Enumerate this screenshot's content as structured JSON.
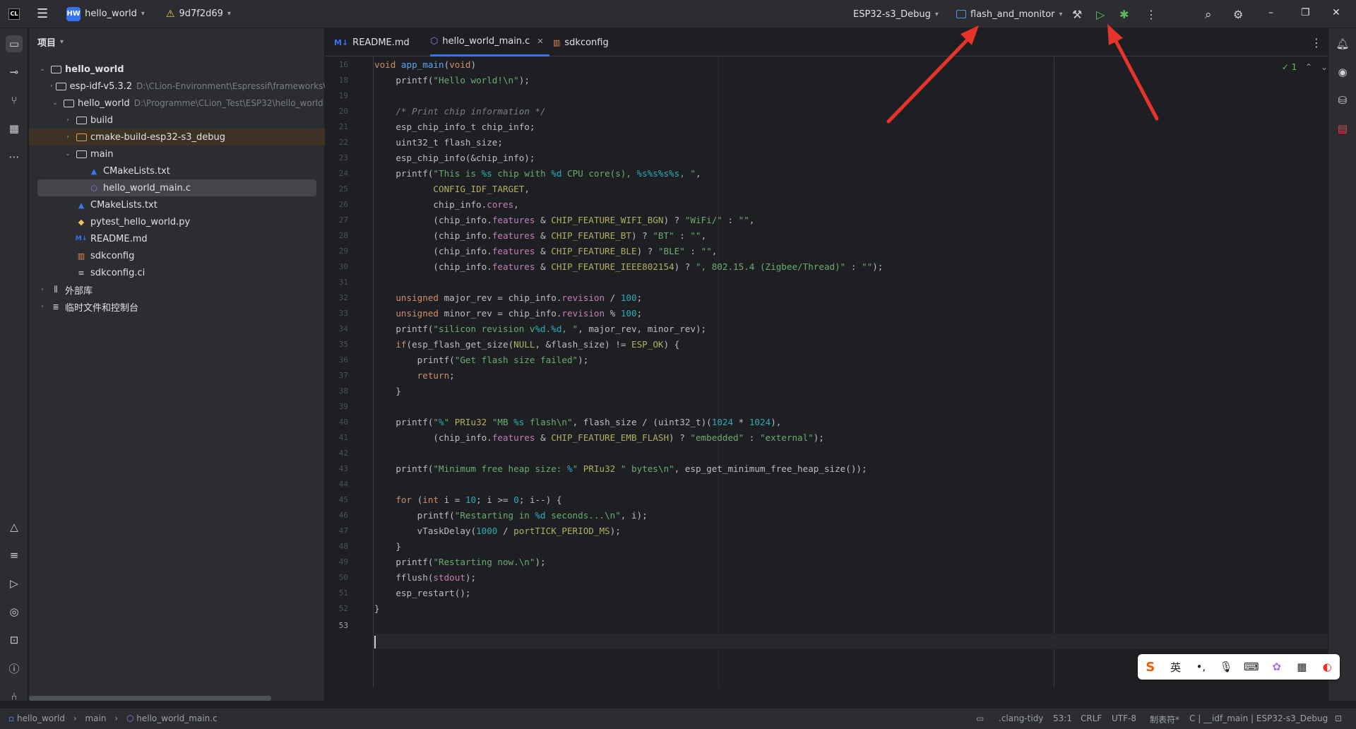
{
  "titlebar": {
    "logo_text": "CL",
    "project_badge": "HW",
    "project_name": "hello_world",
    "branch": "9d7f2d69",
    "run_config": "ESP32-s3_Debug",
    "flash_config": "flash_and_monitor"
  },
  "project_panel": {
    "title": "项目",
    "rows": [
      {
        "label": "hello_world",
        "path": ""
      },
      {
        "label": "esp-idf-v5.3.2",
        "path": "D:\\CLion-Environment\\Espressif\\frameworks\\"
      },
      {
        "label": "hello_world",
        "path": "D:\\Programme\\CLion_Test\\ESP32\\hello_world"
      },
      {
        "label": "build",
        "path": ""
      },
      {
        "label": "cmake-build-esp32-s3_debug",
        "path": ""
      },
      {
        "label": "main",
        "path": ""
      },
      {
        "label": "CMakeLists.txt",
        "path": ""
      },
      {
        "label": "hello_world_main.c",
        "path": ""
      },
      {
        "label": "CMakeLists.txt",
        "path": ""
      },
      {
        "label": "pytest_hello_world.py",
        "path": ""
      },
      {
        "label": "README.md",
        "path": ""
      },
      {
        "label": "sdkconfig",
        "path": ""
      },
      {
        "label": "sdkconfig.ci",
        "path": ""
      },
      {
        "label": "外部库",
        "path": ""
      },
      {
        "label": "临时文件和控制台",
        "path": ""
      }
    ]
  },
  "tabs": [
    {
      "label": "README.md",
      "icon": "M↓"
    },
    {
      "label": "hello_world_main.c",
      "icon": "⬡"
    },
    {
      "label": "sdkconfig",
      "icon": "▥"
    }
  ],
  "editor": {
    "inspection_count": "1",
    "line_numbers": [
      "16",
      "18",
      "19",
      "20",
      "21",
      "22",
      "23",
      "24",
      "25",
      "26",
      "27",
      "28",
      "29",
      "30",
      "31",
      "32",
      "33",
      "34",
      "35",
      "36",
      "37",
      "38",
      "39",
      "40",
      "41",
      "42",
      "43",
      "44",
      "45",
      "46",
      "47",
      "48",
      "49",
      "50",
      "51",
      "52",
      "53"
    ]
  },
  "ime": {
    "logo": "S",
    "lang": "英"
  },
  "statusbar": {
    "crumb_project": "hello_world",
    "crumb_folder": "main",
    "crumb_file": "hello_world_main.c",
    "linter": ".clang-tidy",
    "position": "53:1",
    "line_sep": "CRLF",
    "encoding": "UTF-8",
    "indent": "制表符*",
    "context": "C | __idf_main | ESP32-s3_Debug"
  },
  "colors": {
    "accent": "#3574f0",
    "run_green": "#5fb865",
    "arrow_red": "#e8332a"
  }
}
